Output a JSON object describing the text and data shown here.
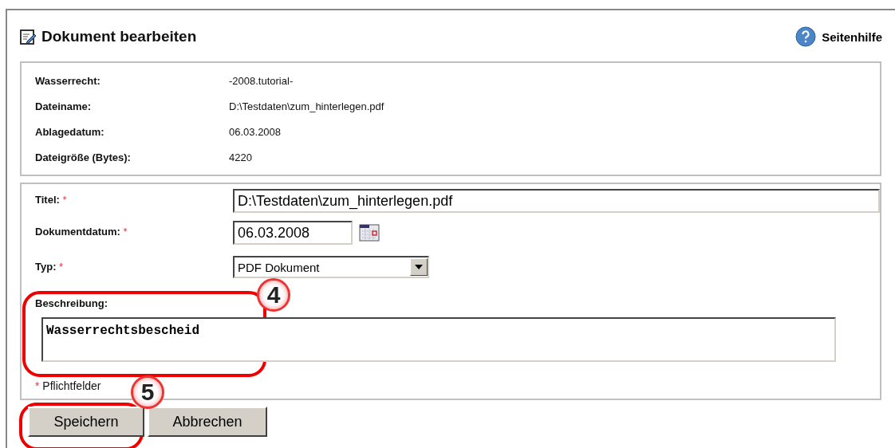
{
  "header": {
    "title": "Dokument bearbeiten",
    "help_link": "Seitenhilfe"
  },
  "info": [
    {
      "label": "Wasserrecht:",
      "value": "-2008.tutorial-"
    },
    {
      "label": "Dateiname:",
      "value": "D:\\Testdaten\\zum_hinterlegen.pdf"
    },
    {
      "label": "Ablagedatum:",
      "value": "06.03.2008"
    },
    {
      "label": "Dateigröße (Bytes):",
      "value": "4220"
    }
  ],
  "form": [
    {
      "kind": "text",
      "label": "Titel:",
      "required": true,
      "value": "D:\\Testdaten\\zum_hinterlegen.pdf"
    },
    {
      "kind": "date",
      "label": "Dokumentdatum:",
      "required": true,
      "value": "06.03.2008"
    },
    {
      "kind": "select",
      "label": "Typ:",
      "required": true,
      "value": "PDF Dokument"
    },
    {
      "kind": "textarea",
      "label": "Beschreibung:",
      "required": false,
      "value": "Wasserrechtsbescheid"
    }
  ],
  "required_note": {
    "mark": "*",
    "text": "Pflichtfelder"
  },
  "buttons": [
    "Speichern",
    "Abbrechen"
  ],
  "callouts": [
    "4",
    "5"
  ]
}
